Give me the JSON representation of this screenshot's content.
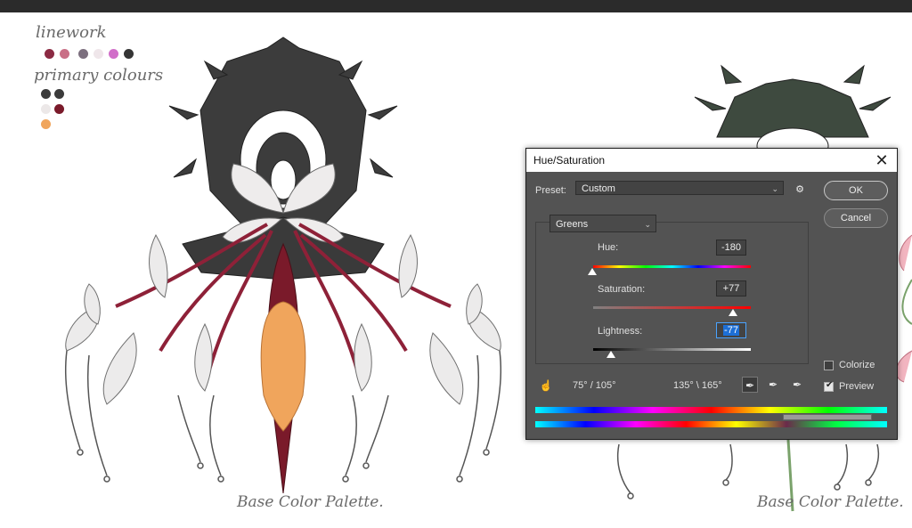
{
  "canvas": {
    "notes": {
      "linework": "linework",
      "primary": "primary colours"
    },
    "swatches": {
      "linework": [
        "#8b2a43",
        "#c96f86",
        "#7c6f7e",
        "#efe6ea",
        "#d16ec9",
        "#353535"
      ],
      "primary": [
        "#3b3b3b",
        "#3b3b3b",
        "#ece8e8",
        "#7a1a2a",
        "#f0a55c"
      ]
    },
    "caption_left": "Base Color Palette.",
    "caption_right": "Base Color Palette."
  },
  "dialog": {
    "title": "Hue/Saturation",
    "close_icon": "close-icon",
    "preset_label": "Preset:",
    "preset_value": "Custom",
    "channel": "Greens",
    "ok": "OK",
    "cancel": "Cancel",
    "hue_label": "Hue:",
    "hue_value": "-180",
    "saturation_label": "Saturation:",
    "saturation_value": "+77",
    "lightness_label": "Lightness:",
    "lightness_value": "-77",
    "range_left": "75° / 105°",
    "range_right": "135° \\ 165°",
    "colorize_label": "Colorize",
    "colorize_checked": false,
    "preview_label": "Preview",
    "preview_checked": true
  }
}
